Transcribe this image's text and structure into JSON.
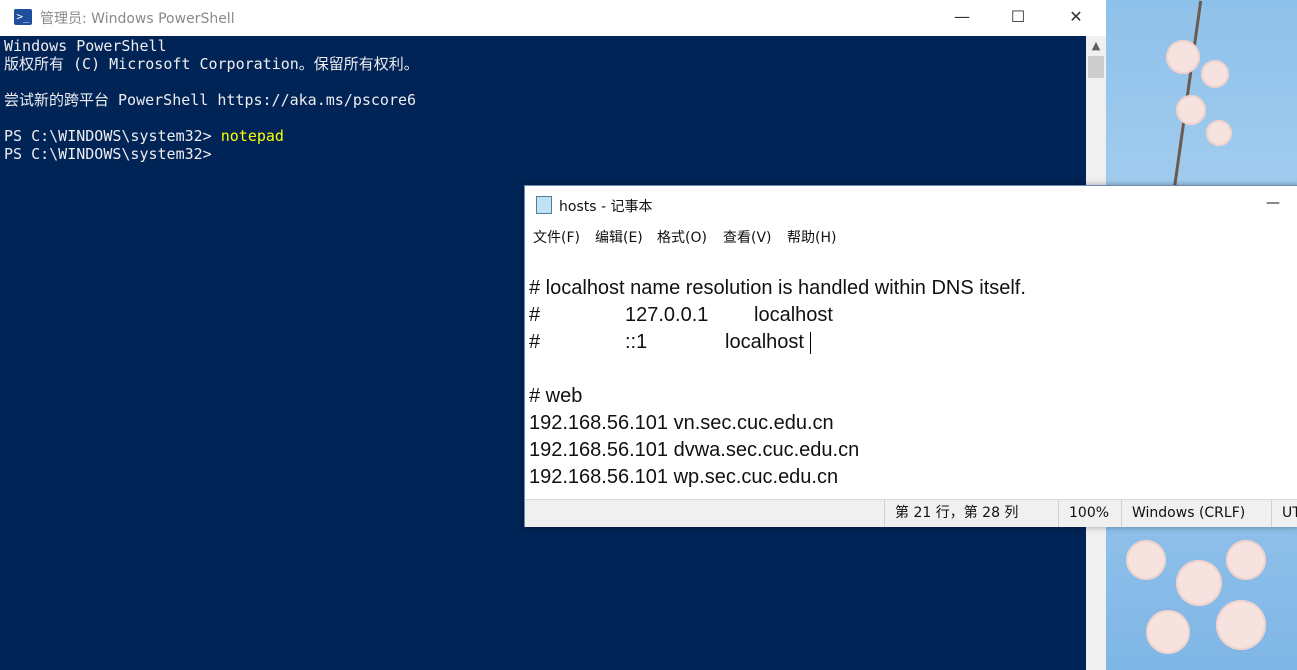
{
  "powershell": {
    "title": "管理员: Windows PowerShell",
    "icon": "powershell-icon",
    "icon_glyph": ">_",
    "controls": {
      "minimize": "—",
      "maximize": "☐",
      "close": "✕"
    },
    "console": {
      "header1": "Windows PowerShell",
      "header2": "版权所有 (C) Microsoft Corporation。保留所有权利。",
      "header3": "尝试新的跨平台 PowerShell https://aka.ms/pscore6",
      "prompt1": "PS C:\\WINDOWS\\system32> ",
      "command1": "notepad",
      "prompt2": "PS C:\\WINDOWS\\system32> "
    },
    "scroll_up": "▲"
  },
  "notepad": {
    "title": "hosts - 记事本",
    "icon": "notepad-icon",
    "minimize": "—",
    "menu": [
      "文件(F)",
      "编辑(E)",
      "格式(O)",
      "查看(V)",
      "帮助(H)"
    ],
    "lines": {
      "l1": "# localhost name resolution is handled within DNS itself.",
      "l2a": "#",
      "l2b": "127.0.0.1",
      "l2c": "localhost",
      "l3a": "#",
      "l3b": "::1",
      "l3c": "localhost",
      "l4": "# web",
      "l5": "192.168.56.101 vn.sec.cuc.edu.cn",
      "l6": "192.168.56.101 dvwa.sec.cuc.edu.cn",
      "l7": "192.168.56.101 wp.sec.cuc.edu.cn"
    },
    "status": {
      "position": "第 21 行，第 28 列",
      "zoom": "100%",
      "line_ending": "Windows (CRLF)",
      "encoding": "UT"
    }
  }
}
